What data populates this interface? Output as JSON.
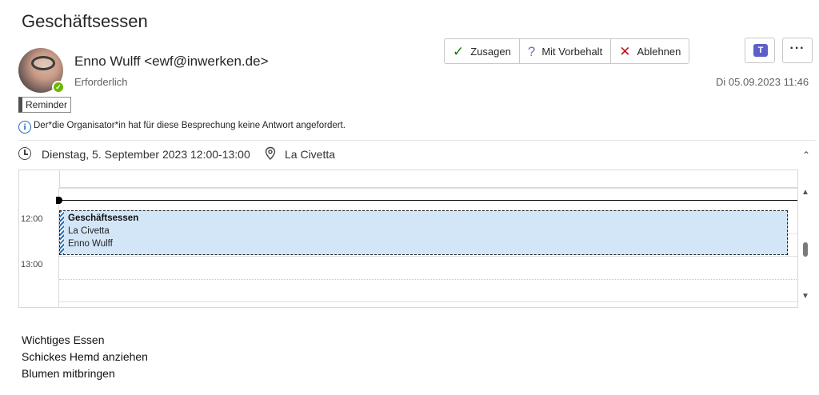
{
  "subject": "Geschäftsessen",
  "sender": {
    "display": "Enno Wulff <ewf@inwerken.de>",
    "attendance": "Erforderlich"
  },
  "category": {
    "label": "Reminder"
  },
  "info": {
    "text": "Der*die Organisator*in hat für diese Besprechung keine Antwort angefordert."
  },
  "meeting": {
    "datetime": "Dienstag, 5. September 2023 12:00-13:00",
    "location": "La Civetta"
  },
  "response_buttons": [
    {
      "label": "Zusagen",
      "icon": "check-icon",
      "color": "#107c10"
    },
    {
      "label": "Mit Vorbehalt",
      "icon": "question-icon",
      "color": "#8764b8"
    },
    {
      "label": "Ablehnen",
      "icon": "x-icon",
      "color": "#c50f1f"
    }
  ],
  "sent_date": "Di 05.09.2023 11:46",
  "calendar": {
    "times": [
      "12:00",
      "13:00"
    ],
    "event": {
      "title": "Geschäftsessen",
      "location": "La Civetta",
      "organizer": "Enno Wulff"
    }
  },
  "body": {
    "lines": [
      "Wichtiges Essen",
      "Schickes Hemd anziehen",
      "Blumen mitbringen"
    ]
  },
  "colors": {
    "presence": "#6bb700",
    "event_bg": "#d3e6f7",
    "teams": "#5b5fc7",
    "info": "#2266c0"
  }
}
